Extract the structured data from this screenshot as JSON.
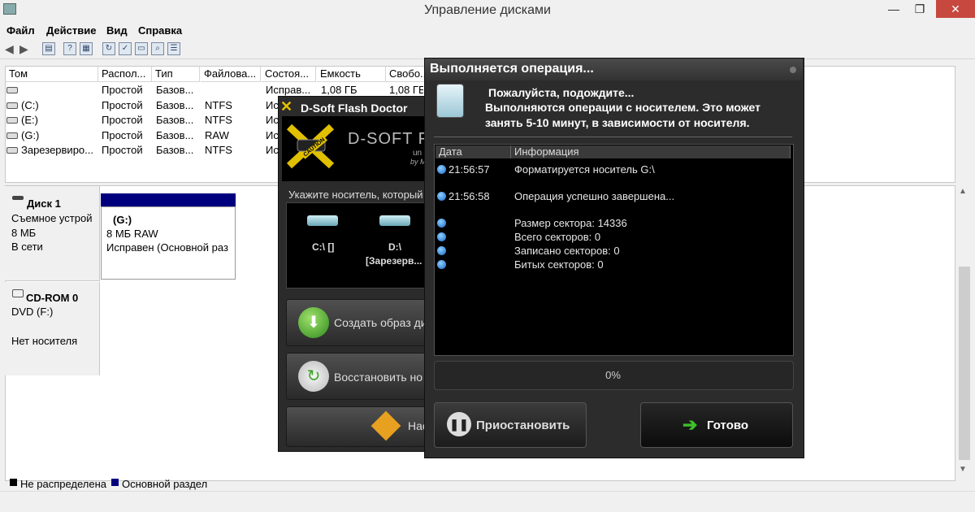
{
  "window": {
    "title": "Управление дисками",
    "controls": {
      "minimize": "—",
      "maximize": "❐",
      "close": "✕"
    }
  },
  "menu": [
    "Файл",
    "Действие",
    "Вид",
    "Справка"
  ],
  "toolbar": {
    "icons": [
      "back-icon",
      "forward-icon",
      "properties-icon",
      "help-icon",
      "refresh-icon",
      "rescan-icon",
      "open-icon",
      "explore-icon",
      "properties2-icon"
    ]
  },
  "volume_list": {
    "columns": [
      "Том",
      "Распол...",
      "Тип",
      "Файлова...",
      "Состоя...",
      "Емкость",
      "Свобо..."
    ],
    "rows": [
      [
        "",
        "Простой",
        "Базов...",
        "",
        "Исправ...",
        "1,08 ГБ",
        "1,08 ГБ"
      ],
      [
        "(C:)",
        "Простой",
        "Базов...",
        "NTFS",
        "Ис",
        "",
        ""
      ],
      [
        "(E:)",
        "Простой",
        "Базов...",
        "NTFS",
        "Ис",
        "",
        ""
      ],
      [
        "(G:)",
        "Простой",
        "Базов...",
        "RAW",
        "Ис",
        "",
        ""
      ],
      [
        "Зарезервиро...",
        "Простой",
        "Базов...",
        "NTFS",
        "Ис",
        "",
        ""
      ]
    ]
  },
  "disks": [
    {
      "name": "Диск 1",
      "type": "Съемное устрой",
      "size": "8 МБ",
      "status": "В сети",
      "partition": {
        "label": "(G:)",
        "size_fs": "8 МБ RAW",
        "status": "Исправен (Основной раз"
      }
    },
    {
      "name": "CD-ROM 0",
      "type": "DVD (F:)",
      "size": "",
      "status": "Нет носителя"
    }
  ],
  "legend": {
    "unallocated": "Не распределена",
    "primary": "Основной раздел"
  },
  "dsoft": {
    "title": "D-Soft Flash Doctor",
    "banner_text": "D-SOFT FLASH",
    "banner_sub1": "un",
    "banner_sub2": "by M",
    "caution": "CAUTION",
    "prompt": "Укажите носитель, который",
    "drives": [
      {
        "label": "C:\\ []"
      },
      {
        "label": "D:\\",
        "sub": "[Зарезерв..."
      }
    ],
    "create_image": "Создать образ ди",
    "restore": "Восстановить но",
    "settings": "Нас"
  },
  "operation": {
    "title": "Выполняется операция...",
    "message": [
      "Пожалуйста, подождите...",
      "Выполняются операции с носителем. Это может",
      "занять 5-10 минут, в зависимости от носителя."
    ],
    "log_columns": [
      "Дата",
      "Информация"
    ],
    "log": [
      {
        "time": "21:56:57",
        "info": "Форматируется носитель G:\\"
      },
      {
        "time": "21:56:58",
        "info": "Операция успешно завершена..."
      },
      {
        "time": "",
        "info": "Размер сектора: 14336"
      },
      {
        "time": "",
        "info": "Всего секторов: 0"
      },
      {
        "time": "",
        "info": "Записано секторов: 0"
      },
      {
        "time": "",
        "info": "Битых секторов: 0"
      }
    ],
    "progress_text": "0%",
    "progress": 0,
    "pause_button": "Приостановить",
    "done_button": "Готово"
  }
}
